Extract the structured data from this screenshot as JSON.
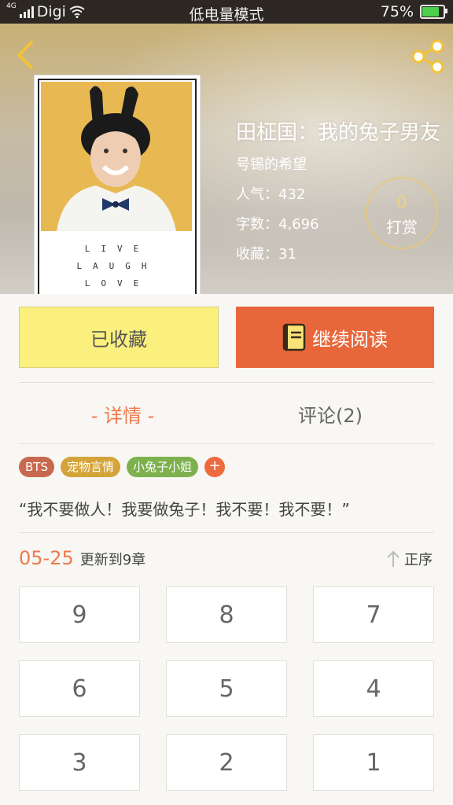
{
  "status_bar": {
    "network": "Digi",
    "network_type": "4G",
    "mode": "低电量模式",
    "battery": "75%",
    "battery_level": 0.75
  },
  "header": {
    "back_icon": "chevron-left-icon",
    "share_icon": "share-icon",
    "cover_motto": [
      "LIVE",
      "LAUGH",
      "LOVE"
    ]
  },
  "book": {
    "title": "田柾国：我的兔子男友",
    "author": "号锡的希望",
    "popularity": "人气：432",
    "word_count": "字数：4,696",
    "favorites": "收藏：31"
  },
  "tip": {
    "count": "0",
    "label": "打赏"
  },
  "actions": {
    "favorite_label": "已收藏",
    "read_label": "继续阅读",
    "read_icon": "book-icon"
  },
  "tabs": {
    "details": "- 详情 -",
    "comments": "评论(2)"
  },
  "tags": [
    {
      "label": "BTS",
      "color": "#c8694f"
    },
    {
      "label": "宠物言情",
      "color": "#d4a43a"
    },
    {
      "label": "小兔子小姐",
      "color": "#7db14e"
    }
  ],
  "tag_add": "+",
  "description": "“我不要做人！我要做兔子！我不要！我不要！”",
  "update": {
    "date": "05-25",
    "text": "更新到9章",
    "order_label": "正序"
  },
  "chapters": [
    "9",
    "8",
    "7",
    "6",
    "5",
    "4",
    "3",
    "2",
    "1"
  ],
  "colors": {
    "accent": "#ee7a4c",
    "read_button": "#e8673a",
    "favorite_button": "#fbf07e"
  }
}
